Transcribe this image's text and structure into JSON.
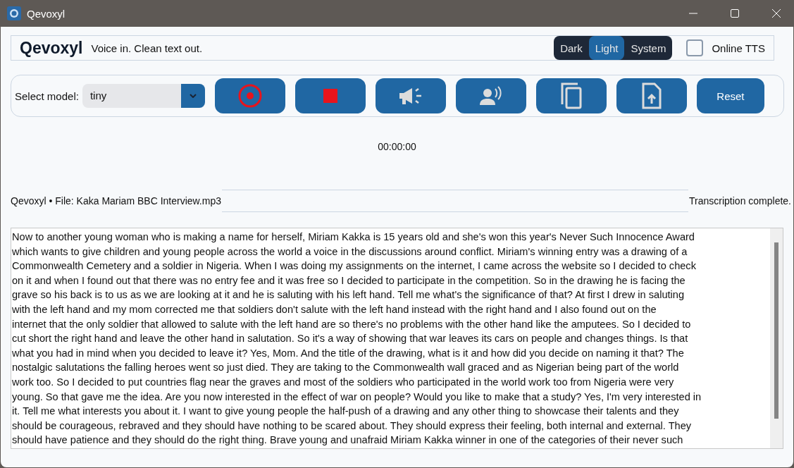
{
  "window": {
    "title": "Qevoxyl"
  },
  "header": {
    "app_name": "Qevoxyl",
    "tagline": "Voice in. Clean text out.",
    "theme_options": [
      {
        "label": "Dark",
        "selected": false
      },
      {
        "label": "Light",
        "selected": true
      },
      {
        "label": "System",
        "selected": false
      }
    ],
    "online_tts": {
      "label": "Online TTS",
      "checked": false
    }
  },
  "toolbar": {
    "model_label": "Select model:",
    "model_value": "tiny",
    "buttons": [
      {
        "kind": "record"
      },
      {
        "kind": "stop"
      },
      {
        "kind": "speak"
      },
      {
        "kind": "voice"
      },
      {
        "kind": "copy"
      },
      {
        "kind": "export"
      },
      {
        "kind": "text",
        "label": "Reset"
      }
    ]
  },
  "timer": "00:00:00",
  "status": {
    "file": "Qevoxyl • File: Kaka Mariam BBC Interview.mp3",
    "message": "Transcription complete."
  },
  "transcript_lines": [
    " Now to another young woman who is making a name for herself, Miriam Kakka is 15 years old and she's won this year's Never Such Innocence Award",
    "which wants to give children and young people across the world a voice in the discussions around conflict. Miriam's winning entry was a drawing of a",
    "Commonwealth Cemetery and a soldier in Nigeria. When I was doing my assignments on the internet, I came across the website so I decided to check",
    "on it and when I found out that there was no entry fee and it was free so I decided to participate in the competition. So in the drawing he is facing the",
    "grave so his back is to us as we are looking at it and he is saluting with his left hand. Tell me what's the significance of that? At first I drew in saluting",
    "with the left hand and my mom corrected me that soldiers don't salute with the left hand instead with the right hand and I also found out on the",
    "internet that the only soldier that allowed to salute with the left hand are so there's no problems with the other hand like the amputees. So I decided to",
    "cut short the right hand and leave the other hand in salutation. So it's a way of showing that war leaves its cars on people and changes things. Is that",
    "what you had in mind when you decided to leave it? Yes, Mom. And the title of the drawing, what is it and how did you decide on naming it that? The",
    "nostalgic salutations the falling heroes went so just died. They are taking to the Commonwealth wall graced and as Nigerian being part of the world",
    "work too. So I decided to put countries flag near the graves and most of the soldiers who participated in the world work too from Nigeria were very",
    "young. So that gave me the idea. Are you now interested in the effect of war on people? Would you like to make that a study? Yes, I'm very interested in",
    "it. Tell me what interests you about it. I want to give young people the half-push of a drawing and any other thing to showcase their talents and they",
    "should be courageous, rebraved and they should have nothing to be scared about. They should express their feeling, both internal and external. They",
    "should have patience and they should do the right thing. Brave young and unafraid Miriam Kakka winner in one of the categories of their never such"
  ]
}
